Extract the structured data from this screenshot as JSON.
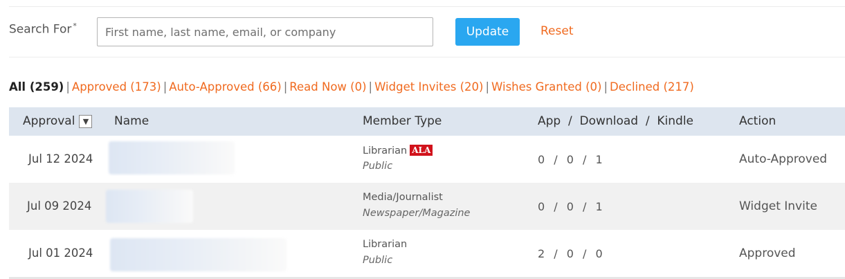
{
  "search": {
    "label": "Search For",
    "required_mark": "*",
    "placeholder": "First name, last name, email, or company",
    "value": "",
    "update_label": "Update",
    "reset_label": "Reset"
  },
  "filters": {
    "active": "All (259)",
    "links": [
      "Approved (173)",
      "Auto-Approved (66)",
      "Read Now (0)",
      "Widget Invites (20)",
      "Wishes Granted (0)",
      "Declined (217)"
    ],
    "separator": "|"
  },
  "table": {
    "headers": {
      "approval": "Approval",
      "sort_glyph": "▼",
      "name": "Name",
      "member_type": "Member Type",
      "counts": "App  /  Download  /  Kindle",
      "action": "Action"
    },
    "rows": [
      {
        "date": "Jul 12 2024",
        "member_type": "Librarian",
        "badge": "ALA",
        "sub_type": "Public",
        "counts": "0 / 0 / 1",
        "action": "Auto-Approved"
      },
      {
        "date": "Jul 09 2024",
        "member_type": "Media/Journalist",
        "badge": "",
        "sub_type": "Newspaper/Magazine",
        "counts": "0 / 0 / 1",
        "action": "Widget Invite"
      },
      {
        "date": "Jul 01 2024",
        "member_type": "Librarian",
        "badge": "",
        "sub_type": "Public",
        "counts": "2 / 0 / 0",
        "action": "Approved"
      }
    ]
  },
  "colors": {
    "accent_link": "#f06a1f",
    "button_blue": "#2aa7f0",
    "header_bg": "#dde5ef",
    "ala_badge": "#d1121b"
  }
}
